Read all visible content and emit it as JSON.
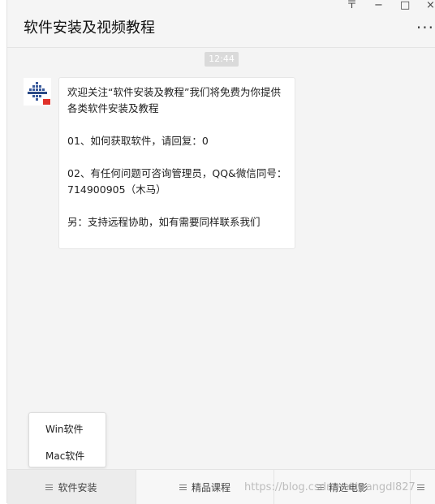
{
  "window": {
    "title": "软件安装及视频教程",
    "controls": {
      "pin": "〒",
      "minimize": "−",
      "maximize": "□",
      "close": "×",
      "more": "···"
    }
  },
  "chat": {
    "timestamp": "12:44",
    "message": {
      "lines": [
        "欢迎关注“软件安装及教程”我们将免费为你提供各类软件安装及教程",
        "01、如何获取软件，请回复：0",
        "02、有任何问题可咨询管理员，QQ&微信同号：714900905（木马）",
        "另：支持远程协助，如有需要同样联系我们"
      ]
    }
  },
  "submenu": {
    "items": [
      "Win软件",
      "Mac软件"
    ]
  },
  "bottom_menu": {
    "tabs": [
      {
        "label": "软件安装"
      },
      {
        "label": "精品课程"
      },
      {
        "label": "精选电影"
      }
    ]
  },
  "watermark": "https://blog.csdn.net/wangdl827",
  "colors": {
    "background": "#f4f4f4",
    "bubble": "#ffffff",
    "avatar_blue": "#3a5a9c",
    "avatar_red": "#e0312a"
  }
}
